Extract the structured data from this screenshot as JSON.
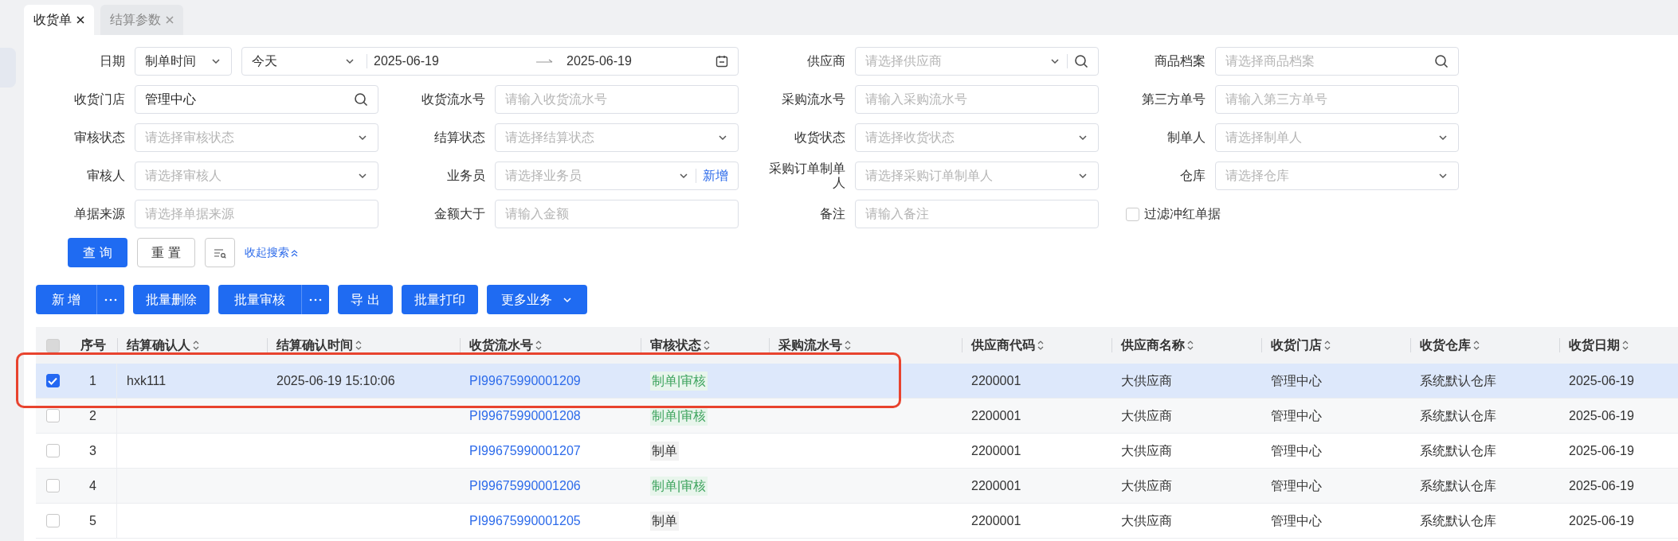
{
  "tabs": [
    {
      "label": "收货单",
      "selected": true
    },
    {
      "label": "结算参数",
      "selected": false
    }
  ],
  "filters": [
    {
      "kind": "date",
      "label": "日期",
      "type_value": "制单时间",
      "preset": "今天",
      "start": "2025-06-19",
      "end": "2025-06-19"
    },
    {
      "kind": "select-search",
      "label": "供应商",
      "placeholder": "请选择供应商"
    },
    {
      "kind": "search",
      "label": "商品档案",
      "placeholder": "请选择商品档案"
    },
    {
      "kind": "search",
      "label": "收货门店",
      "value": "管理中心"
    },
    {
      "kind": "input",
      "label": "收货流水号",
      "placeholder": "请输入收货流水号"
    },
    {
      "kind": "input",
      "label": "采购流水号",
      "placeholder": "请输入采购流水号"
    },
    {
      "kind": "input",
      "label": "第三方单号",
      "placeholder": "请输入第三方单号"
    },
    {
      "kind": "select",
      "label": "审核状态",
      "placeholder": "请选择审核状态"
    },
    {
      "kind": "select",
      "label": "结算状态",
      "placeholder": "请选择结算状态"
    },
    {
      "kind": "select",
      "label": "收货状态",
      "placeholder": "请选择收货状态"
    },
    {
      "kind": "select",
      "label": "制单人",
      "placeholder": "请选择制单人"
    },
    {
      "kind": "select",
      "label": "审核人",
      "placeholder": "请选择审核人"
    },
    {
      "kind": "select",
      "label": "业务员",
      "placeholder": "请选择业务员",
      "link": "新增"
    },
    {
      "kind": "select",
      "label": "采购订单制单人",
      "placeholder": "请选择采购订单制单人"
    },
    {
      "kind": "select",
      "label": "仓库",
      "placeholder": "请选择仓库"
    },
    {
      "kind": "input",
      "label": "单据来源",
      "placeholder": "请选择单据来源"
    },
    {
      "kind": "input",
      "label": "金额大于",
      "placeholder": "请输入金额"
    },
    {
      "kind": "input",
      "label": "备注",
      "placeholder": "请输入备注"
    },
    {
      "kind": "checkbox",
      "label": "过滤冲红单据",
      "checked": false
    }
  ],
  "search_actions": {
    "query": "查 询",
    "reset": "重 置",
    "collapse": "收起搜索"
  },
  "toolbar": [
    {
      "label": "新 增",
      "kind": "split"
    },
    {
      "label": "批量删除",
      "kind": "plain"
    },
    {
      "label": "批量审核",
      "kind": "split"
    },
    {
      "label": "导 出",
      "kind": "plain"
    },
    {
      "label": "批量打印",
      "kind": "plain"
    },
    {
      "label": "更多业务",
      "kind": "dropdown"
    }
  ],
  "table": {
    "header_checkbox": {
      "disabled": true
    },
    "columns": [
      {
        "label": "序号",
        "sortable": false
      },
      {
        "label": "结算确认人",
        "sortable": true
      },
      {
        "label": "结算确认时间",
        "sortable": true
      },
      {
        "label": "收货流水号",
        "sortable": true
      },
      {
        "label": "审核状态",
        "sortable": true
      },
      {
        "label": "采购流水号",
        "sortable": true
      },
      {
        "label": "供应商代码",
        "sortable": true
      },
      {
        "label": "供应商名称",
        "sortable": true
      },
      {
        "label": "收货门店",
        "sortable": true
      },
      {
        "label": "收货仓库",
        "sortable": true
      },
      {
        "label": "收货日期",
        "sortable": true
      }
    ],
    "rows": [
      {
        "selected": true,
        "checked": true,
        "framed": true,
        "no": "1",
        "confirmer": "hxk111",
        "confirm_time": "2025-06-19 15:10:06",
        "receipt_no": "PI99675990001209",
        "status": {
          "text": "制单|审核",
          "kind": "approved"
        },
        "supplier_code": "2200001",
        "supplier_name": "大供应商",
        "store": "管理中心",
        "warehouse": "系统默认仓库",
        "date": "2025-06-19"
      },
      {
        "selected": false,
        "checked": false,
        "framed": false,
        "no": "2",
        "receipt_no": "PI99675990001208",
        "status": {
          "text": "制单|审核",
          "kind": "approved"
        },
        "supplier_code": "2200001",
        "supplier_name": "大供应商",
        "store": "管理中心",
        "warehouse": "系统默认仓库",
        "date": "2025-06-19"
      },
      {
        "selected": false,
        "checked": false,
        "framed": false,
        "no": "3",
        "receipt_no": "PI99675990001207",
        "status": {
          "text": "制单",
          "kind": "draft"
        },
        "supplier_code": "2200001",
        "supplier_name": "大供应商",
        "store": "管理中心",
        "warehouse": "系统默认仓库",
        "date": "2025-06-19"
      },
      {
        "selected": false,
        "checked": false,
        "framed": false,
        "no": "4",
        "receipt_no": "PI99675990001206",
        "status": {
          "text": "制单|审核",
          "kind": "approved"
        },
        "supplier_code": "2200001",
        "supplier_name": "大供应商",
        "store": "管理中心",
        "warehouse": "系统默认仓库",
        "date": "2025-06-19"
      },
      {
        "selected": false,
        "checked": false,
        "framed": false,
        "no": "5",
        "receipt_no": "PI99675990001205",
        "status": {
          "text": "制单",
          "kind": "draft"
        },
        "supplier_code": "2200001",
        "supplier_name": "大供应商",
        "store": "管理中心",
        "warehouse": "系统默认仓库",
        "date": "2025-06-19"
      }
    ]
  }
}
